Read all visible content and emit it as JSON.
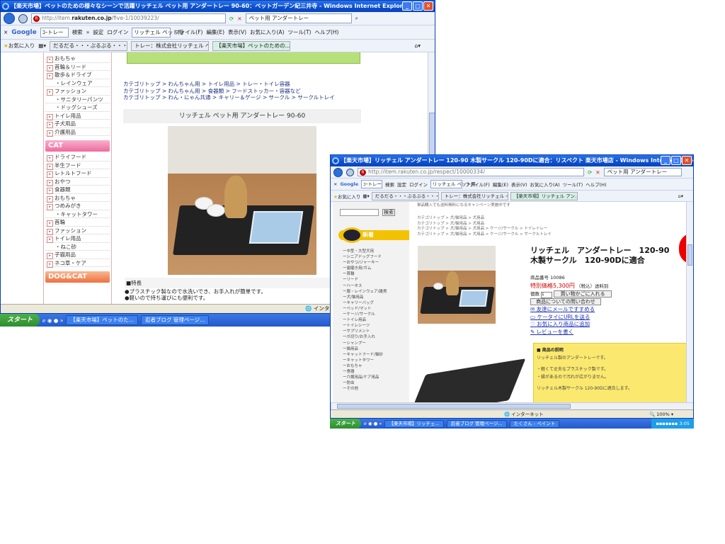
{
  "window1": {
    "title": "【楽天市場】ペットのための様々なシーンで活躍リッチェル ペット用 アンダートレー 90-60：ペットガーデン紀三井寺 - Windows Internet Explorer",
    "url_prefix": "http://item.",
    "url_domain": "rakuten.co.jp",
    "url_suffix": "/five-1/10039223/",
    "search_value": "ペット用 アンダートレー",
    "google_box": "ｺｰトレー",
    "search_btn": "検索",
    "settings": "設定",
    "login": "ログイン",
    "find_value": "リッチェル ペット用",
    "menu": [
      "ファイル(F)",
      "編集(E)",
      "表示(V)",
      "お気に入り(A)",
      "ツール(T)",
      "ヘルプ(H)"
    ],
    "favorites": "お気に入り",
    "tabs": [
      "だるだる・・・ぶるぶる・・・。やっ...",
      "トレー：株式会社リッチェル ペッ...",
      "【楽天市場】ペットのための..."
    ],
    "sidebar_dog": [
      {
        "t": "おもちゃ",
        "s": 0
      },
      {
        "t": "首輪＆リード",
        "s": 0
      },
      {
        "t": "散歩＆ドライブ",
        "s": 0
      },
      {
        "t": "・レインウェア",
        "s": 1
      },
      {
        "t": "ファッション",
        "s": 0
      },
      {
        "t": "・サニタリーパンツ",
        "s": 1
      },
      {
        "t": "・ドッグシューズ",
        "s": 1
      },
      {
        "t": "トイレ用品",
        "s": 0
      },
      {
        "t": "子犬用品",
        "s": 0
      },
      {
        "t": "介護用品",
        "s": 0
      }
    ],
    "cat_header": "CAT",
    "sidebar_cat": [
      {
        "t": "ドライフード",
        "s": 0
      },
      {
        "t": "半生フード",
        "s": 0
      },
      {
        "t": "レトルトフード",
        "s": 0
      },
      {
        "t": "おやつ",
        "s": 0
      },
      {
        "t": "食器類",
        "s": 0
      },
      {
        "t": "おもちゃ",
        "s": 0
      },
      {
        "t": "つめみがき",
        "s": 0
      },
      {
        "t": "・キャットタワー",
        "s": 1
      },
      {
        "t": "首輪",
        "s": 0
      },
      {
        "t": "ファッション",
        "s": 0
      },
      {
        "t": "トイレ用品",
        "s": 0
      },
      {
        "t": "・ねこ砂",
        "s": 1
      },
      {
        "t": "子猫用品",
        "s": 0
      },
      {
        "t": "ネコ草・ケア",
        "s": 0
      }
    ],
    "dogcat_header": "DOG&CAT",
    "breadcrumbs": [
      "カテゴリトップ > わんちゃん用 > トイレ用品 > トレー・トイレ容器",
      "カテゴリトップ > わんちゃん用 > 食器類 > フードストッカー・容器など",
      "カテゴリトップ > わん・にゃん共通 > キャリー＆ゲージ > サークル > サークルトレイ"
    ],
    "product_title": "リッチェル ペット用 アンダートレー 90-60",
    "features_header": "■特長",
    "features": [
      "●プラスチック製なので水洗いでき、お手入れが簡単です。",
      "●軽いので持ち運びにも便利です。"
    ],
    "status_zone": "インターネット"
  },
  "taskbar1": {
    "start": "スタート",
    "items": [
      "【楽天市場】ペットのた...",
      "忍者ブログ 管理ページ..."
    ]
  },
  "window2": {
    "title": "【楽天市場】リッチェル アンダートレー 120-90 木製サークル 120-90Dに適合：リスペクト 楽天市場店 - Windows Internet Explorer",
    "url": "http://item.rakuten.co.jp/respect/10000334/",
    "search_value": "ペット用 アンダートレー",
    "google_box": "ｺｰトレー",
    "search_btn": "検索",
    "settings": "設定",
    "login": "ログイン",
    "find_value": "リッチェル ペット用",
    "menu": [
      "ファイル(F)",
      "編集(E)",
      "表示(V)",
      "お気に入り(A)",
      "ツール(T)",
      "ヘルプ(H)"
    ],
    "favorites": "お気に入り",
    "tabs": [
      "だるだる・・・ぶるぶる・・・。やっ...",
      "トレー：株式会社リッチェル ペッ...",
      "【楽天市場】リッチェル アン..."
    ],
    "top_text": "単品購入でも送料無料になるキャンペーン実施中です",
    "search_button": "検索",
    "new_header": "新着",
    "sidebar": [
      "ー中型・大型犬用",
      "ーシニアドッグフード",
      "ーおやつ/ジャーキー",
      "ー歯磨き用/ガム",
      "ー首輪",
      "ーリード",
      "ーハーネス",
      "ー服・レインウェア/雑貨",
      "ー犬/猫用品",
      "ーキャリーバッグ",
      "ーベッド/マット",
      "ーケージ/サークル",
      "ートイレ用品",
      "ートイレシーツ",
      "ーサプリメント",
      "ー爪切り/お手入れ",
      "ーシャンプー",
      "ー猫用品",
      "ーキャットフード/猫砂",
      "ーキャットタワー",
      "ーおもちゃ",
      "ー食器",
      "ー介護用品/ケア用品",
      "ー防虫",
      "ーその他"
    ],
    "breadcrumbs": [
      "カテゴリトップ > 犬/猫用品 > 犬用品",
      "カテゴリトップ > 犬/猫用品 > 犬用品",
      "カテゴリトップ > 犬/猫用品 > 犬用品 > ケージ/サークル > トイレトレー",
      "カテゴリトップ > 犬/猫用品 > 犬用品 > ケージ/サークル > サークルトレイ"
    ],
    "product_title_1": "リッチェル　アンダートレー　120-90",
    "product_title_2": "木製サークル　120-90Dに適合",
    "item_number": "商品番号 10086",
    "price": "特別価格5,300円",
    "price_note": "（税込）送料別",
    "qty_label": "個数",
    "qty_value": "1",
    "cart_button": "買い物かごに入れる",
    "inquiry_button": "商品についての問い合わせ",
    "links": [
      "友達にメールですすめる",
      "ケータイにURLを送る",
      "お気に入り商品に追加",
      "レビューを書く"
    ],
    "desc_header": "■ 商品の説明",
    "desc": [
      "リッチェル製のアンダートレーです。",
      "・軽くて丈夫なプラスチック製です。",
      "・縁があるので汚れが広がりません。",
      "リッチェル木製サークル 120-90Dに適合します。"
    ],
    "status_zone": "インターネット",
    "zoom": "100%"
  },
  "taskbar2": {
    "start": "スタート",
    "items": [
      "【楽天市場】リッチェ...",
      "忍者ブログ 管理ページ...",
      "たくさん - ペイント"
    ],
    "clock": "3:05"
  },
  "colors": {
    "ie_title": "#0b4fd0",
    "cat_header": "#f07aa8",
    "dogcat_header": "#f08050",
    "price_red": "#cc0000",
    "yellow_box": "#fbe96f",
    "new_header": "#f2c200"
  }
}
